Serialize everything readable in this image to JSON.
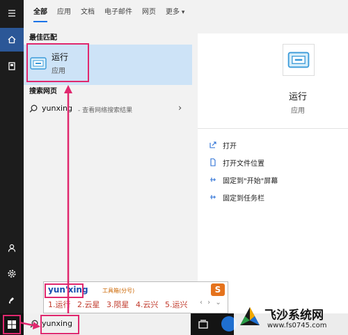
{
  "tabs": [
    "全部",
    "应用",
    "文档",
    "电子邮件",
    "网页",
    "更多"
  ],
  "sections": {
    "best_match": "最佳匹配",
    "web_search": "搜索网页"
  },
  "best_match": {
    "title": "运行",
    "subtitle": "应用"
  },
  "web_result": {
    "query": "yunxing",
    "suffix": "- 查看网络搜索结果"
  },
  "detail": {
    "title": "运行",
    "subtitle": "应用",
    "actions": [
      "打开",
      "打开文件位置",
      "固定到\"开始\"屏幕",
      "固定到任务栏"
    ]
  },
  "taskbar": {
    "search_text": "yunxing"
  },
  "ime": {
    "pinyin": "yun'xing",
    "hint": "工具箱(分号)",
    "candidates": [
      "1.运行",
      "2.云星",
      "3.陨星",
      "4.云兴",
      "5.运兴"
    ]
  },
  "watermark": {
    "name": "飞沙系统网",
    "url": "www.fs0745.com"
  },
  "colors": {
    "accent": "#1a73e8",
    "selected": "#cde3f7",
    "annotation": "#e0286e"
  },
  "icons": {
    "rail": [
      "menu-icon",
      "home-icon",
      "document-icon",
      "user-icon",
      "settings-icon",
      "feedback-icon"
    ],
    "start": "windows-logo-icon"
  }
}
